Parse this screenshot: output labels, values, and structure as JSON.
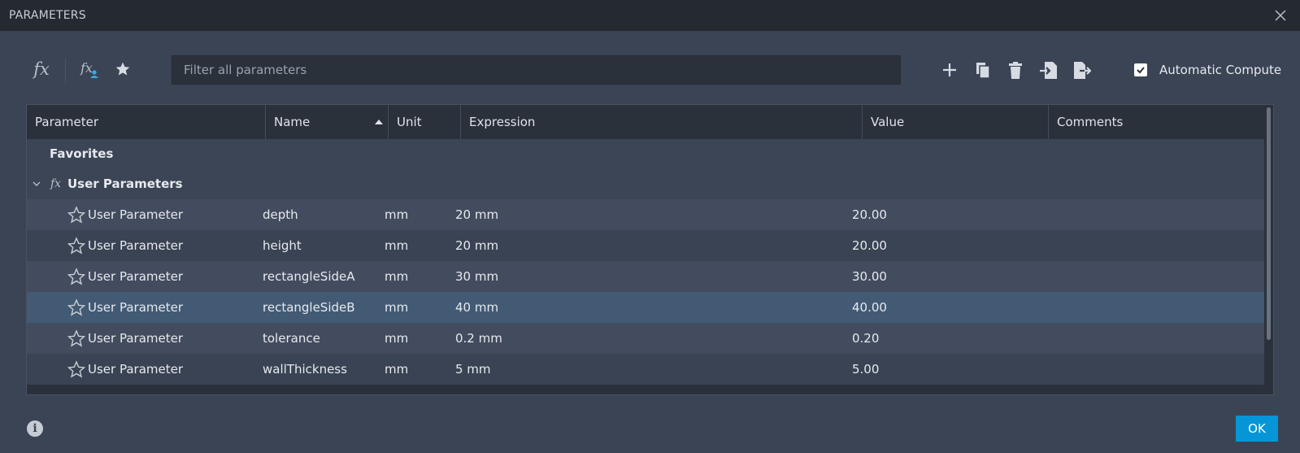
{
  "window": {
    "title": "PARAMETERS"
  },
  "toolbar": {
    "fx_icon": "fx-icon",
    "user_param_icon": "fx-user-icon",
    "favorites_icon": "star-icon",
    "search_placeholder": "Filter all parameters",
    "actions": [
      "add-icon",
      "copy-icon",
      "delete-icon",
      "import-icon",
      "export-icon"
    ],
    "automatic_compute_label": "Automatic Compute",
    "automatic_compute_checked": true
  },
  "table": {
    "columns": [
      "Parameter",
      "Name",
      "Unit",
      "Expression",
      "Value",
      "Comments"
    ],
    "sorted_column": "Name",
    "sort_direction": "ascending",
    "favorites_label": "Favorites",
    "group_label": "User Parameters",
    "rows": [
      {
        "parameter": "User Parameter",
        "name": "depth",
        "unit": "mm",
        "expression": "20 mm",
        "value": "20.00",
        "comments": ""
      },
      {
        "parameter": "User Parameter",
        "name": "height",
        "unit": "mm",
        "expression": "20 mm",
        "value": "20.00",
        "comments": ""
      },
      {
        "parameter": "User Parameter",
        "name": "rectangleSideA",
        "unit": "mm",
        "expression": "30 mm",
        "value": "30.00",
        "comments": ""
      },
      {
        "parameter": "User Parameter",
        "name": "rectangleSideB",
        "unit": "mm",
        "expression": "40 mm",
        "value": "40.00",
        "comments": ""
      },
      {
        "parameter": "User Parameter",
        "name": "tolerance",
        "unit": "mm",
        "expression": "0.2 mm",
        "value": "0.20",
        "comments": ""
      },
      {
        "parameter": "User Parameter",
        "name": "wallThickness",
        "unit": "mm",
        "expression": "5 mm",
        "value": "5.00",
        "comments": ""
      }
    ],
    "selected_row": 3
  },
  "footer": {
    "ok_label": "OK",
    "info_icon": "info-icon"
  },
  "colors": {
    "accent": "#0696d7",
    "background": "#3b4455",
    "selected_row": "#425a74"
  }
}
